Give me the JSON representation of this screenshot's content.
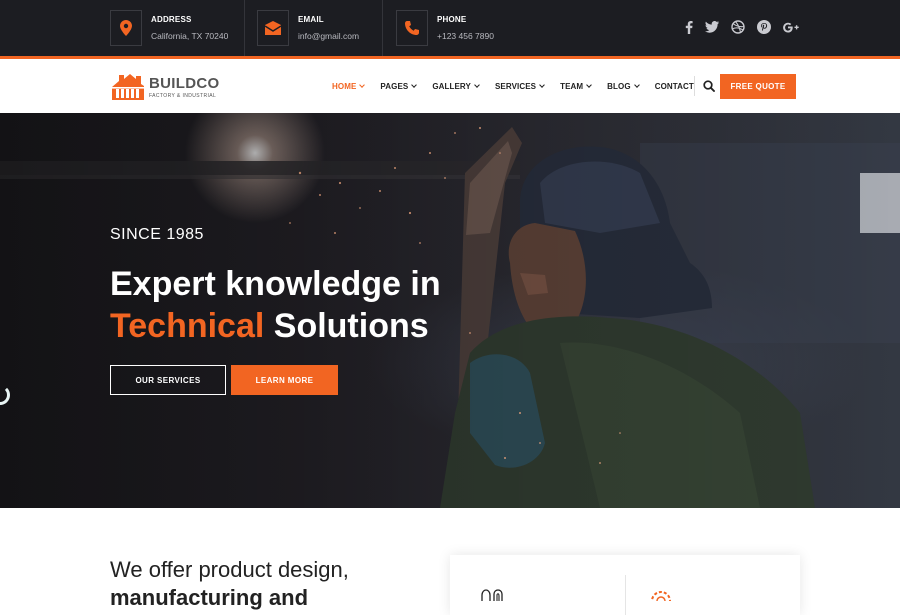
{
  "topbar": {
    "contacts": [
      {
        "icon": "map-pin-icon",
        "title": "ADDRESS",
        "value": "California, TX 70240"
      },
      {
        "icon": "envelope-icon",
        "title": "EMAIL",
        "value": "info@gmail.com"
      },
      {
        "icon": "phone-icon",
        "title": "PHONE",
        "value": "+123 456 7890"
      }
    ],
    "social": [
      "facebook-icon",
      "twitter-icon",
      "dribbble-icon",
      "pinterest-icon",
      "google-plus-icon"
    ]
  },
  "header": {
    "logo_name": "BUILDCO",
    "logo_tagline": "FACTORY & INDUSTRIAL",
    "nav": [
      {
        "label": "HOME",
        "dropdown": true,
        "active": true
      },
      {
        "label": "PAGES",
        "dropdown": true
      },
      {
        "label": "GALLERY",
        "dropdown": true
      },
      {
        "label": "SERVICES",
        "dropdown": true
      },
      {
        "label": "TEAM",
        "dropdown": true
      },
      {
        "label": "BLOG",
        "dropdown": true
      },
      {
        "label": "CONTACT",
        "dropdown": false
      }
    ],
    "quote_label": "FREE QUOTE"
  },
  "hero": {
    "since": "SINCE 1985",
    "title_line1": "Expert knowledge in",
    "title_accent": "Technical",
    "title_rest": "Solutions",
    "btn_services": "OUR SERVICES",
    "btn_learn": "LEARN MORE"
  },
  "intro": {
    "line1": "We offer product design,",
    "line2": "manufacturing and"
  },
  "colors": {
    "accent": "#f26522",
    "topbar_bg": "#1c1d22",
    "text_dark": "#222222"
  }
}
